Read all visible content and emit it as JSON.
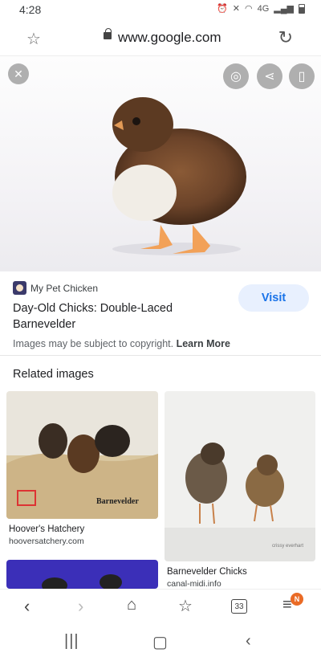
{
  "status_bar": {
    "time": "4:28",
    "network": "4G"
  },
  "browser": {
    "url": "www.google.com"
  },
  "viewer": {
    "close_icon": "close-icon",
    "actions": [
      "lens-icon",
      "share-icon",
      "bookmark-icon"
    ]
  },
  "result": {
    "source": "My Pet Chicken",
    "title": "Day-Old Chicks: Double-Laced Barnevelder",
    "visit_label": "Visit",
    "copyright_text": "Images may be subject to copyright.",
    "learn_more": "Learn More"
  },
  "related": {
    "heading": "Related images",
    "items": [
      {
        "title": "Hoover's Hatchery",
        "site": "hooversatchery.com",
        "watermark": "Barnevelder"
      },
      {
        "title": "Barnevelder Chicks",
        "site": "canal-midi.info",
        "watermark": "crissy everhart"
      }
    ]
  },
  "bottom_nav": {
    "tab_count": "33",
    "menu_badge": "N"
  },
  "colors": {
    "accent": "#1a73e8",
    "visit_bg": "#e8f0fe",
    "badge": "#ea6b26"
  }
}
